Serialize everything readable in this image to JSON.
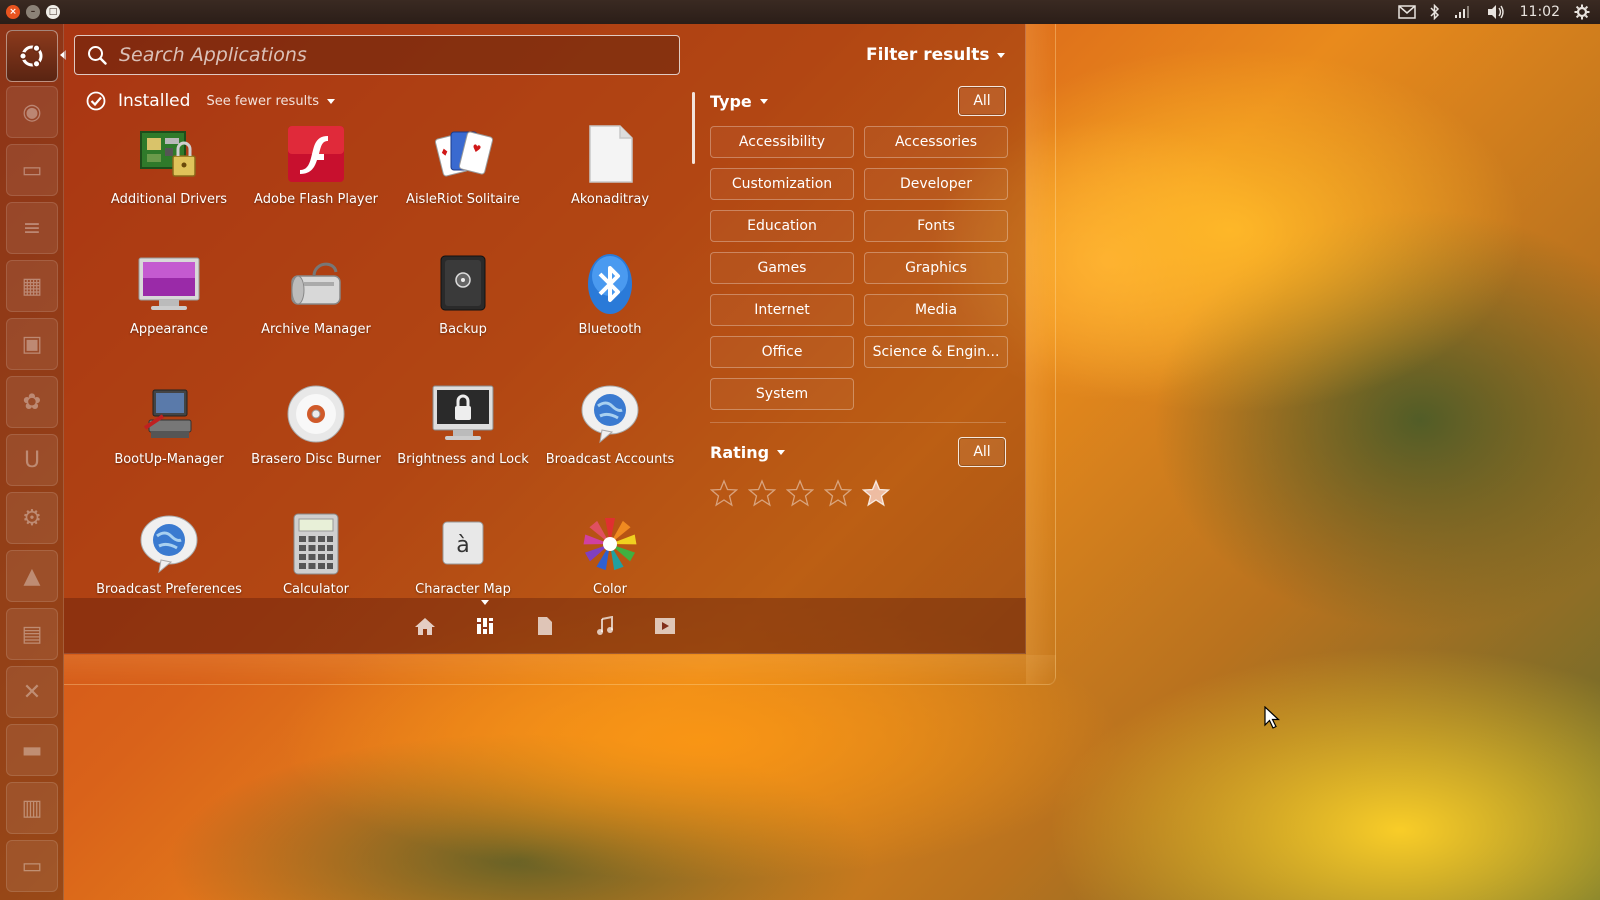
{
  "window_controls": {
    "close": "×",
    "minimize": "–",
    "maximize": "□"
  },
  "panel": {
    "clock": "11:02"
  },
  "search": {
    "placeholder": "Search Applications",
    "value": ""
  },
  "filter_results_label": "Filter results",
  "installed": {
    "label": "Installed",
    "see_fewer": "See fewer results"
  },
  "apps": [
    {
      "label": "Additional Drivers",
      "icon": "additional-drivers-icon"
    },
    {
      "label": "Adobe Flash Player",
      "icon": "flash-player-icon"
    },
    {
      "label": "AisleRiot Solitaire",
      "icon": "solitaire-cards-icon"
    },
    {
      "label": "Akonaditray",
      "icon": "blank-document-icon"
    },
    {
      "label": "Appearance",
      "icon": "appearance-monitor-icon"
    },
    {
      "label": "Archive Manager",
      "icon": "archive-manager-icon"
    },
    {
      "label": "Backup",
      "icon": "backup-safe-icon"
    },
    {
      "label": "Bluetooth",
      "icon": "bluetooth-icon"
    },
    {
      "label": "BootUp-Manager",
      "icon": "bootup-manager-icon"
    },
    {
      "label": "Brasero Disc Burner",
      "icon": "disc-burner-icon"
    },
    {
      "label": "Brightness and Lock",
      "icon": "brightness-lock-icon"
    },
    {
      "label": "Broadcast Accounts",
      "icon": "broadcast-accounts-icon"
    },
    {
      "label": "Broadcast Preferences",
      "icon": "broadcast-preferences-icon"
    },
    {
      "label": "Calculator",
      "icon": "calculator-icon"
    },
    {
      "label": "Character Map",
      "icon": "character-map-icon"
    },
    {
      "label": "Color",
      "icon": "color-flower-icon"
    }
  ],
  "filters": {
    "type": {
      "label": "Type",
      "all": "All",
      "categories": [
        "Accessibility",
        "Accessories",
        "Customization",
        "Developer",
        "Education",
        "Fonts",
        "Games",
        "Graphics",
        "Internet",
        "Media",
        "Office",
        "Science & Engin...",
        "System"
      ]
    },
    "rating": {
      "label": "Rating",
      "all": "All",
      "stars": 5,
      "selected_star": 5
    }
  },
  "character_map_glyph": "à",
  "lenses": [
    "home-lens-icon",
    "applications-lens-icon",
    "files-lens-icon",
    "music-lens-icon",
    "video-lens-icon"
  ],
  "colors": {
    "accent": "#e9541f",
    "panel": "#2b1e18"
  }
}
